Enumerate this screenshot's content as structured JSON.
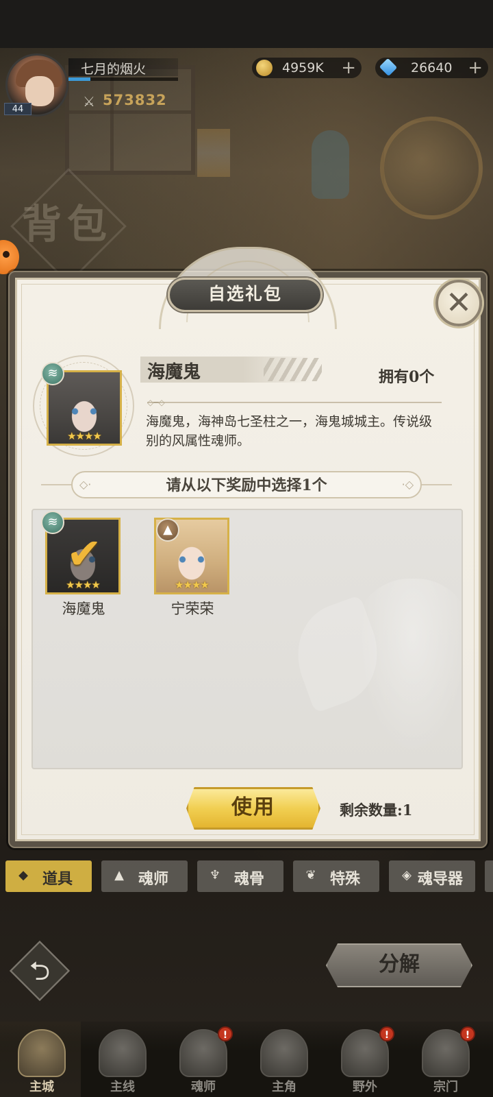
{
  "player": {
    "name": "七月的烟火",
    "level": "44",
    "power": "573832",
    "exp_fraction": 0.2
  },
  "currency": {
    "gold": "4959K",
    "gems": "26640",
    "plus": "+"
  },
  "background_title": "背包",
  "dialog": {
    "title": "自选礼包",
    "close": "✕",
    "item": {
      "name": "海魔鬼",
      "owned": "拥有0个",
      "description": "海魔鬼，海神岛七圣柱之一，海鬼城城主。传说级别的风属性魂师。",
      "stars": "★★★★",
      "element": "wind"
    },
    "choose_prompt": "请从以下奖励中选择1个",
    "rewards": [
      {
        "name": "海魔鬼",
        "stars": "★★★★",
        "element": "wind",
        "selected": true
      },
      {
        "name": "宁荣荣",
        "stars": "★★★★",
        "element": "earth",
        "selected": false
      }
    ],
    "use_button": "使用",
    "remaining": "剩余数量:1"
  },
  "tabs": [
    {
      "label": "道具",
      "icon": "bag-icon",
      "active": true
    },
    {
      "label": "魂师",
      "icon": "hood-icon",
      "active": false
    },
    {
      "label": "魂骨",
      "icon": "bone-icon",
      "active": false
    },
    {
      "label": "特殊",
      "icon": "wing-icon",
      "active": false
    },
    {
      "label": "魂导器",
      "icon": "gem-icon",
      "active": false
    }
  ],
  "actions": {
    "back": "⮌",
    "decompose": "分解"
  },
  "nav": [
    {
      "label": "主城",
      "active": true,
      "alert": false
    },
    {
      "label": "主线",
      "active": false,
      "alert": false
    },
    {
      "label": "魂师",
      "active": false,
      "alert": true
    },
    {
      "label": "主角",
      "active": false,
      "alert": false
    },
    {
      "label": "野外",
      "active": false,
      "alert": true
    },
    {
      "label": "宗门",
      "active": false,
      "alert": true
    }
  ],
  "alert_mark": "!",
  "colors": {
    "accent_gold": "#f1cf52",
    "tab_active": "#cfae42",
    "alert_red": "#c4361f"
  }
}
